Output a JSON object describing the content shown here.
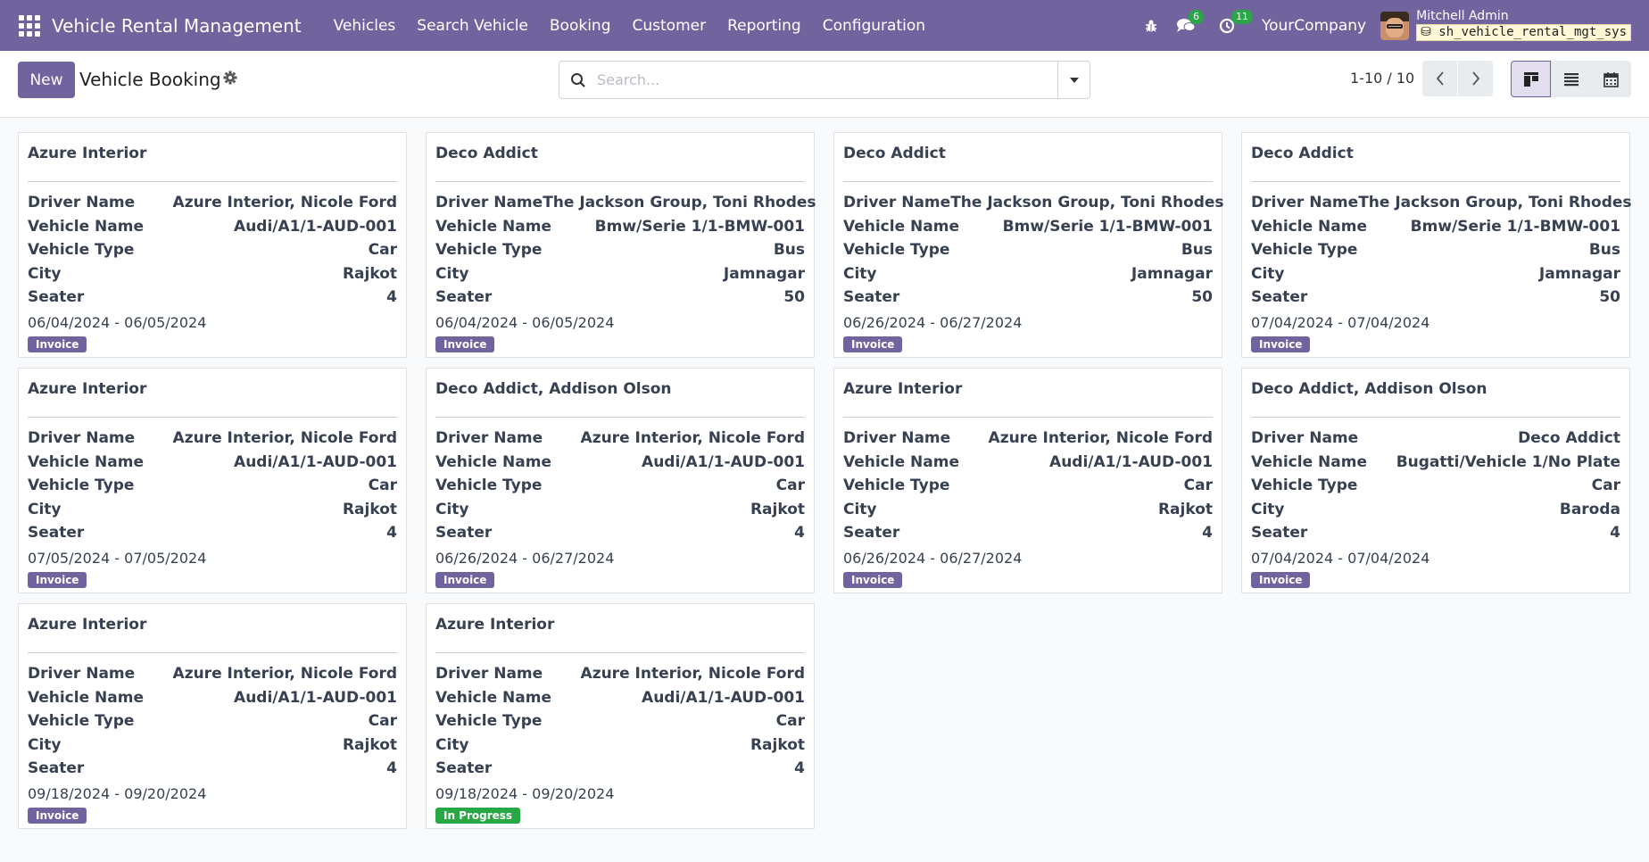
{
  "navbar": {
    "app_title": "Vehicle Rental Management",
    "menu": [
      "Vehicles",
      "Search Vehicle",
      "Booking",
      "Customer",
      "Reporting",
      "Configuration"
    ],
    "messages_count": "6",
    "activities_count": "11",
    "company": "YourCompany",
    "user_name": "Mitchell Admin",
    "database": "sh_vehicle_rental_mgt_sys"
  },
  "control": {
    "new_label": "New",
    "page_title": "Vehicle Booking",
    "search_placeholder": "Search...",
    "pager": "1-10 / 10"
  },
  "labels": {
    "driver": "Driver Name",
    "vehicle": "Vehicle Name",
    "type": "Vehicle Type",
    "city": "City",
    "seater": "Seater"
  },
  "colors": {
    "brand": "#71639e",
    "status_invoice": "#71639e",
    "status_in_progress": "#28a745"
  },
  "cards": [
    {
      "title": "Azure Interior",
      "driver": "Azure Interior, Nicole Ford",
      "vehicle": "Audi/A1/1-AUD-001",
      "type": "Car",
      "city": "Rajkot",
      "seater": "4",
      "dates": "06/04/2024 - 06/05/2024",
      "status": "Invoice"
    },
    {
      "title": "Deco Addict",
      "driver": "The Jackson Group, Toni Rhodes",
      "vehicle": "Bmw/Serie 1/1-BMW-001",
      "type": "Bus",
      "city": "Jamnagar",
      "seater": "50",
      "dates": "06/04/2024 - 06/05/2024",
      "status": "Invoice"
    },
    {
      "title": "Deco Addict",
      "driver": "The Jackson Group, Toni Rhodes",
      "vehicle": "Bmw/Serie 1/1-BMW-001",
      "type": "Bus",
      "city": "Jamnagar",
      "seater": "50",
      "dates": "06/26/2024 - 06/27/2024",
      "status": "Invoice"
    },
    {
      "title": "Deco Addict",
      "driver": "The Jackson Group, Toni Rhodes",
      "vehicle": "Bmw/Serie 1/1-BMW-001",
      "type": "Bus",
      "city": "Jamnagar",
      "seater": "50",
      "dates": "07/04/2024 - 07/04/2024",
      "status": "Invoice"
    },
    {
      "title": "Azure Interior",
      "driver": "Azure Interior, Nicole Ford",
      "vehicle": "Audi/A1/1-AUD-001",
      "type": "Car",
      "city": "Rajkot",
      "seater": "4",
      "dates": "07/05/2024 - 07/05/2024",
      "status": "Invoice"
    },
    {
      "title": "Deco Addict, Addison Olson",
      "driver": "Azure Interior, Nicole Ford",
      "vehicle": "Audi/A1/1-AUD-001",
      "type": "Car",
      "city": "Rajkot",
      "seater": "4",
      "dates": "06/26/2024 - 06/27/2024",
      "status": "Invoice"
    },
    {
      "title": "Azure Interior",
      "driver": "Azure Interior, Nicole Ford",
      "vehicle": "Audi/A1/1-AUD-001",
      "type": "Car",
      "city": "Rajkot",
      "seater": "4",
      "dates": "06/26/2024 - 06/27/2024",
      "status": "Invoice"
    },
    {
      "title": "Deco Addict, Addison Olson",
      "driver": "Deco Addict",
      "vehicle": "Bugatti/Vehicle 1/No Plate",
      "type": "Car",
      "city": "Baroda",
      "seater": "4",
      "dates": "07/04/2024 - 07/04/2024",
      "status": "Invoice"
    },
    {
      "title": "Azure Interior",
      "driver": "Azure Interior, Nicole Ford",
      "vehicle": "Audi/A1/1-AUD-001",
      "type": "Car",
      "city": "Rajkot",
      "seater": "4",
      "dates": "09/18/2024 - 09/20/2024",
      "status": "Invoice"
    },
    {
      "title": "Azure Interior",
      "driver": "Azure Interior, Nicole Ford",
      "vehicle": "Audi/A1/1-AUD-001",
      "type": "Car",
      "city": "Rajkot",
      "seater": "4",
      "dates": "09/18/2024 - 09/20/2024",
      "status": "In Progress"
    }
  ]
}
